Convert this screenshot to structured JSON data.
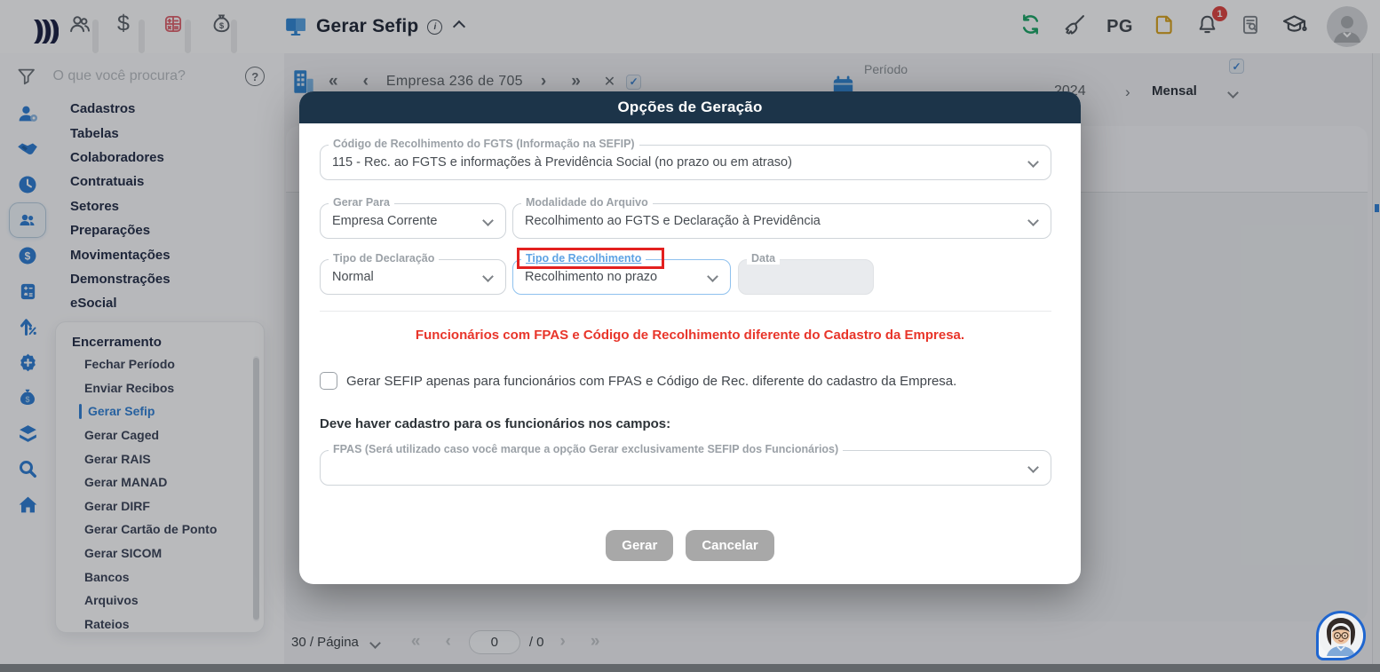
{
  "topbar": {
    "title": "Gerar Sefip",
    "pg_label": "PG",
    "bell_badge": "1"
  },
  "sidebar": {
    "search_placeholder": "O que você procura?",
    "menu": [
      "Cadastros",
      "Tabelas",
      "Colaboradores",
      "Contratuais",
      "Setores",
      "Preparações",
      "Movimentações",
      "Demonstrações",
      "eSocial"
    ],
    "submenu": {
      "header": "Encerramento",
      "items": [
        "Fechar Período",
        "Enviar Recibos",
        "Gerar Sefip",
        "Gerar Caged",
        "Gerar RAIS",
        "Gerar MANAD",
        "Gerar DIRF",
        "Gerar Cartão de Ponto",
        "Gerar SICOM",
        "Bancos",
        "Arquivos",
        "Rateios"
      ],
      "selected_item": "Gerar Sefip"
    }
  },
  "main": {
    "company_nav": "Empresa 236 de 705",
    "period": {
      "label": "Período",
      "year_visible": "2024",
      "mode": "Mensal"
    },
    "pagination": {
      "per_page": "30 / Página",
      "page_value": "0",
      "page_total": "/ 0"
    }
  },
  "modal": {
    "title": "Opções de Geração",
    "fgts_code": {
      "label": "Código de Recolhimento do FGTS (Informação na SEFIP)",
      "value": "115 - Rec. ao FGTS e informações à Previdência Social (no prazo ou em atraso)"
    },
    "gerar_para": {
      "label": "Gerar Para",
      "value": "Empresa Corrente"
    },
    "modalidade": {
      "label": "Modalidade do Arquivo",
      "value": "Recolhimento ao FGTS e Declaração à Previdência"
    },
    "tipo_declaracao": {
      "label": "Tipo de Declaração",
      "value": "Normal"
    },
    "tipo_recolhimento": {
      "label": "Tipo de Recolhimento",
      "value": "Recolhimento no prazo"
    },
    "data_field": {
      "label": "Data",
      "value": ""
    },
    "warning": "Funcionários com FPAS e Código de Recolhimento diferente do Cadastro da Empresa.",
    "checkbox_label": "Gerar SEFIP apenas para funcionários com FPAS e Código de Rec. diferente do cadastro da Empresa.",
    "note": "Deve haver cadastro para os funcionários nos campos:",
    "fpas": {
      "label": "FPAS (Será utilizado caso você marque a opção Gerar exclusivamente SEFIP dos Funcionários)",
      "value": ""
    },
    "buttons": {
      "generate": "Gerar",
      "cancel": "Cancelar"
    }
  },
  "glyphs": {
    "first": "«",
    "prev": "‹",
    "next": "›",
    "last": "»",
    "close": "✕",
    "help": "?",
    "info": "i",
    "check": "✓",
    "dollar": "$"
  },
  "colors": {
    "accent_blue": "#2b7cd3",
    "annotation_red": "#e3201f",
    "warning_red": "#e8352a",
    "modal_header": "#1c3449",
    "badge_red": "#e0413d",
    "refresh_green": "#18a564",
    "file_gold": "#d9a21b"
  }
}
